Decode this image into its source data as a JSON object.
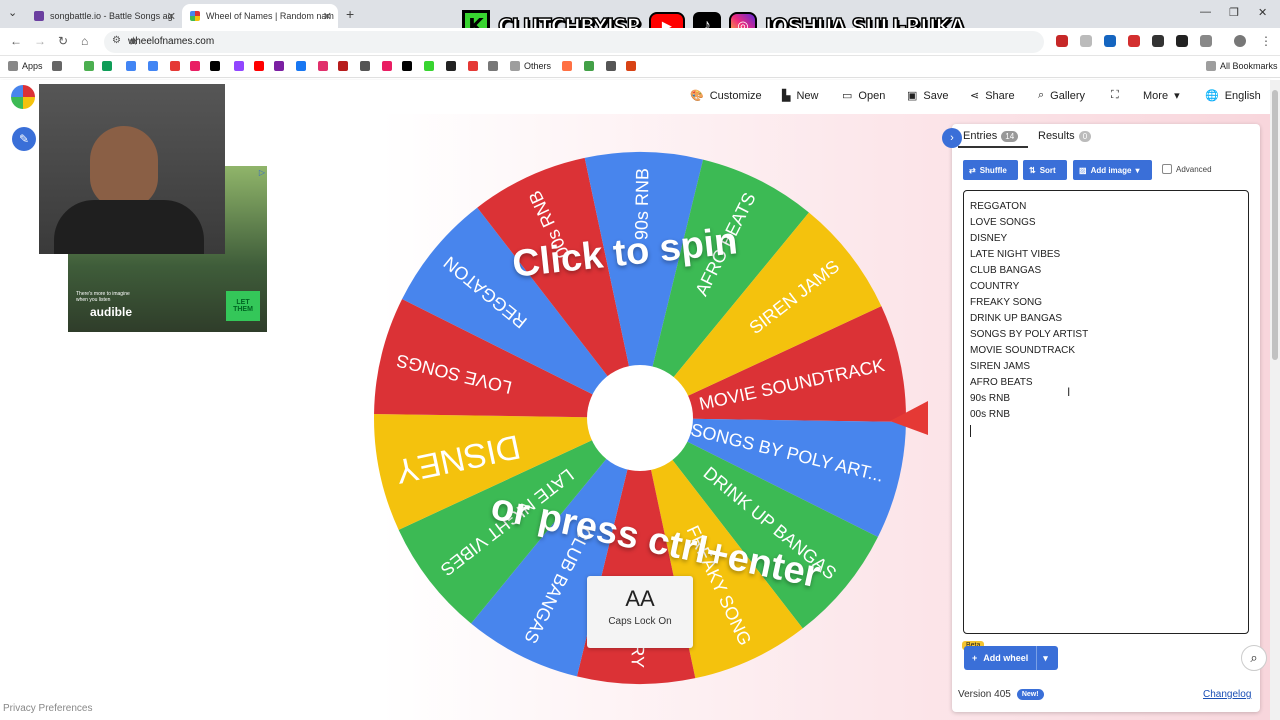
{
  "browser": {
    "tabs": [
      {
        "title": "songbattle.io - Battle Songs ag",
        "favicon_color": "#6b3fa0"
      },
      {
        "title": "Wheel of Names | Random nam",
        "favicon_color": "#4885ed"
      }
    ],
    "url": "wheelofnames.com",
    "bookmarks": {
      "apps_label": "Apps",
      "others_label": "Others",
      "all_label": "All Bookmarks"
    }
  },
  "overlay_banner": {
    "k_letter": "K",
    "left_name": "CLUTCHBYJSR",
    "right_name": "JOSHUA SULI-RUKA"
  },
  "app": {
    "toolbar": {
      "customize": "Customize",
      "new": "New",
      "open": "Open",
      "save": "Save",
      "share": "Share",
      "gallery": "Gallery",
      "more": "More",
      "language": "English"
    }
  },
  "ad": {
    "tagline": "There's more to imagine when you listen",
    "brand": "audible",
    "cta": "LET THEM"
  },
  "wheel": {
    "spin_line1": "Click to spin",
    "spin_line2": "or press ctrl+enter",
    "segments": [
      {
        "label": "MOVIE SOUNDTRACK",
        "color": "#db3236"
      },
      {
        "label": "SONGS BY POLY ART...",
        "color": "#4885ed"
      },
      {
        "label": "DRINK UP BANGAS",
        "color": "#3cba54"
      },
      {
        "label": "FREAKY SONG",
        "color": "#f4c20d"
      },
      {
        "label": "COUNTRY",
        "color": "#db3236"
      },
      {
        "label": "CLUB BANGAS",
        "color": "#4885ed"
      },
      {
        "label": "LATE NIGHT VIBES",
        "color": "#3cba54"
      },
      {
        "label": "DISNEY",
        "color": "#f4c20d"
      },
      {
        "label": "LOVE SONGS",
        "color": "#db3236"
      },
      {
        "label": "REGGATON",
        "color": "#4885ed"
      },
      {
        "label": "00s RNB",
        "color": "#db3236"
      },
      {
        "label": "90s RNB",
        "color": "#4885ed"
      },
      {
        "label": "AFRO BEATS",
        "color": "#3cba54"
      },
      {
        "label": "SIREN JAMS",
        "color": "#f4c20d"
      }
    ]
  },
  "caps_lock": {
    "symbol": "AA",
    "label": "Caps Lock On"
  },
  "panel": {
    "tabs": {
      "entries": "Entries",
      "entries_count": "14",
      "results": "Results",
      "results_count": "0"
    },
    "buttons": {
      "shuffle": "Shuffle",
      "sort": "Sort",
      "add_image": "Add image",
      "advanced": "Advanced"
    },
    "entries": [
      "REGGATON",
      "LOVE SONGS",
      "DISNEY",
      "LATE NIGHT VIBES",
      "CLUB BANGAS",
      "COUNTRY",
      "FREAKY SONG",
      "DRINK UP BANGAS",
      "SONGS BY POLY ARTIST",
      "MOVIE SOUNDTRACK",
      "SIREN JAMS",
      "AFRO BEATS",
      "90s RNB",
      "00s RNB"
    ],
    "add_wheel": "Add wheel",
    "beta": "Beta",
    "version": "Version 405",
    "new_badge": "New!",
    "changelog": "Changelog"
  },
  "footer": {
    "privacy": "Privacy Preferences"
  }
}
